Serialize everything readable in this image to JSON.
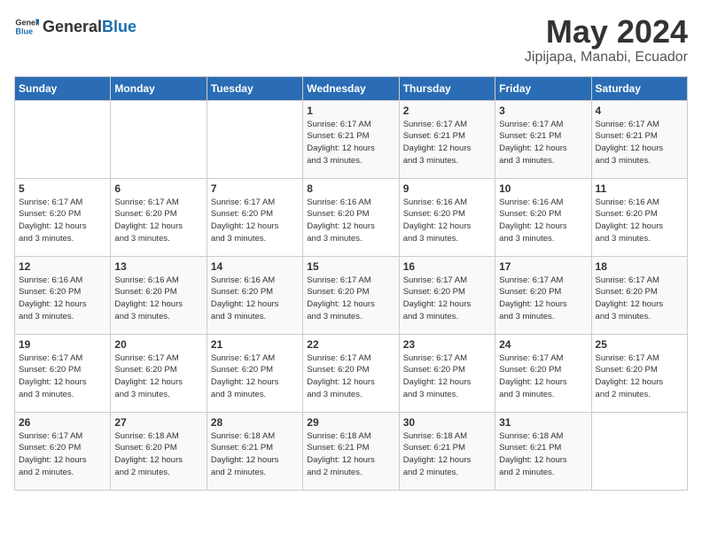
{
  "logo": {
    "general": "General",
    "blue": "Blue"
  },
  "title": "May 2024",
  "subtitle": "Jipijapa, Manabi, Ecuador",
  "header": {
    "days": [
      "Sunday",
      "Monday",
      "Tuesday",
      "Wednesday",
      "Thursday",
      "Friday",
      "Saturday"
    ]
  },
  "weeks": [
    [
      {
        "day": "",
        "info": ""
      },
      {
        "day": "",
        "info": ""
      },
      {
        "day": "",
        "info": ""
      },
      {
        "day": "1",
        "info": "Sunrise: 6:17 AM\nSunset: 6:21 PM\nDaylight: 12 hours\nand 3 minutes."
      },
      {
        "day": "2",
        "info": "Sunrise: 6:17 AM\nSunset: 6:21 PM\nDaylight: 12 hours\nand 3 minutes."
      },
      {
        "day": "3",
        "info": "Sunrise: 6:17 AM\nSunset: 6:21 PM\nDaylight: 12 hours\nand 3 minutes."
      },
      {
        "day": "4",
        "info": "Sunrise: 6:17 AM\nSunset: 6:21 PM\nDaylight: 12 hours\nand 3 minutes."
      }
    ],
    [
      {
        "day": "5",
        "info": "Sunrise: 6:17 AM\nSunset: 6:20 PM\nDaylight: 12 hours\nand 3 minutes."
      },
      {
        "day": "6",
        "info": "Sunrise: 6:17 AM\nSunset: 6:20 PM\nDaylight: 12 hours\nand 3 minutes."
      },
      {
        "day": "7",
        "info": "Sunrise: 6:17 AM\nSunset: 6:20 PM\nDaylight: 12 hours\nand 3 minutes."
      },
      {
        "day": "8",
        "info": "Sunrise: 6:16 AM\nSunset: 6:20 PM\nDaylight: 12 hours\nand 3 minutes."
      },
      {
        "day": "9",
        "info": "Sunrise: 6:16 AM\nSunset: 6:20 PM\nDaylight: 12 hours\nand 3 minutes."
      },
      {
        "day": "10",
        "info": "Sunrise: 6:16 AM\nSunset: 6:20 PM\nDaylight: 12 hours\nand 3 minutes."
      },
      {
        "day": "11",
        "info": "Sunrise: 6:16 AM\nSunset: 6:20 PM\nDaylight: 12 hours\nand 3 minutes."
      }
    ],
    [
      {
        "day": "12",
        "info": "Sunrise: 6:16 AM\nSunset: 6:20 PM\nDaylight: 12 hours\nand 3 minutes."
      },
      {
        "day": "13",
        "info": "Sunrise: 6:16 AM\nSunset: 6:20 PM\nDaylight: 12 hours\nand 3 minutes."
      },
      {
        "day": "14",
        "info": "Sunrise: 6:16 AM\nSunset: 6:20 PM\nDaylight: 12 hours\nand 3 minutes."
      },
      {
        "day": "15",
        "info": "Sunrise: 6:17 AM\nSunset: 6:20 PM\nDaylight: 12 hours\nand 3 minutes."
      },
      {
        "day": "16",
        "info": "Sunrise: 6:17 AM\nSunset: 6:20 PM\nDaylight: 12 hours\nand 3 minutes."
      },
      {
        "day": "17",
        "info": "Sunrise: 6:17 AM\nSunset: 6:20 PM\nDaylight: 12 hours\nand 3 minutes."
      },
      {
        "day": "18",
        "info": "Sunrise: 6:17 AM\nSunset: 6:20 PM\nDaylight: 12 hours\nand 3 minutes."
      }
    ],
    [
      {
        "day": "19",
        "info": "Sunrise: 6:17 AM\nSunset: 6:20 PM\nDaylight: 12 hours\nand 3 minutes."
      },
      {
        "day": "20",
        "info": "Sunrise: 6:17 AM\nSunset: 6:20 PM\nDaylight: 12 hours\nand 3 minutes."
      },
      {
        "day": "21",
        "info": "Sunrise: 6:17 AM\nSunset: 6:20 PM\nDaylight: 12 hours\nand 3 minutes."
      },
      {
        "day": "22",
        "info": "Sunrise: 6:17 AM\nSunset: 6:20 PM\nDaylight: 12 hours\nand 3 minutes."
      },
      {
        "day": "23",
        "info": "Sunrise: 6:17 AM\nSunset: 6:20 PM\nDaylight: 12 hours\nand 3 minutes."
      },
      {
        "day": "24",
        "info": "Sunrise: 6:17 AM\nSunset: 6:20 PM\nDaylight: 12 hours\nand 3 minutes."
      },
      {
        "day": "25",
        "info": "Sunrise: 6:17 AM\nSunset: 6:20 PM\nDaylight: 12 hours\nand 2 minutes."
      }
    ],
    [
      {
        "day": "26",
        "info": "Sunrise: 6:17 AM\nSunset: 6:20 PM\nDaylight: 12 hours\nand 2 minutes."
      },
      {
        "day": "27",
        "info": "Sunrise: 6:18 AM\nSunset: 6:20 PM\nDaylight: 12 hours\nand 2 minutes."
      },
      {
        "day": "28",
        "info": "Sunrise: 6:18 AM\nSunset: 6:21 PM\nDaylight: 12 hours\nand 2 minutes."
      },
      {
        "day": "29",
        "info": "Sunrise: 6:18 AM\nSunset: 6:21 PM\nDaylight: 12 hours\nand 2 minutes."
      },
      {
        "day": "30",
        "info": "Sunrise: 6:18 AM\nSunset: 6:21 PM\nDaylight: 12 hours\nand 2 minutes."
      },
      {
        "day": "31",
        "info": "Sunrise: 6:18 AM\nSunset: 6:21 PM\nDaylight: 12 hours\nand 2 minutes."
      },
      {
        "day": "",
        "info": ""
      }
    ]
  ]
}
